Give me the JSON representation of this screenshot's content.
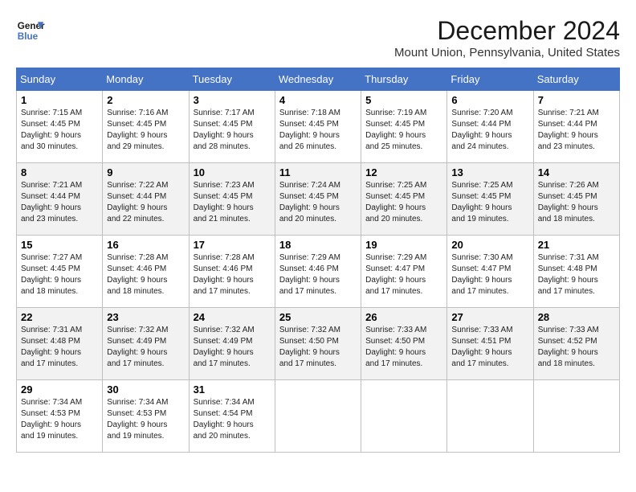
{
  "header": {
    "logo_line1": "General",
    "logo_line2": "Blue",
    "month_title": "December 2024",
    "location": "Mount Union, Pennsylvania, United States"
  },
  "weekdays": [
    "Sunday",
    "Monday",
    "Tuesday",
    "Wednesday",
    "Thursday",
    "Friday",
    "Saturday"
  ],
  "weeks": [
    [
      {
        "day": "1",
        "info": "Sunrise: 7:15 AM\nSunset: 4:45 PM\nDaylight: 9 hours\nand 30 minutes."
      },
      {
        "day": "2",
        "info": "Sunrise: 7:16 AM\nSunset: 4:45 PM\nDaylight: 9 hours\nand 29 minutes."
      },
      {
        "day": "3",
        "info": "Sunrise: 7:17 AM\nSunset: 4:45 PM\nDaylight: 9 hours\nand 28 minutes."
      },
      {
        "day": "4",
        "info": "Sunrise: 7:18 AM\nSunset: 4:45 PM\nDaylight: 9 hours\nand 26 minutes."
      },
      {
        "day": "5",
        "info": "Sunrise: 7:19 AM\nSunset: 4:45 PM\nDaylight: 9 hours\nand 25 minutes."
      },
      {
        "day": "6",
        "info": "Sunrise: 7:20 AM\nSunset: 4:44 PM\nDaylight: 9 hours\nand 24 minutes."
      },
      {
        "day": "7",
        "info": "Sunrise: 7:21 AM\nSunset: 4:44 PM\nDaylight: 9 hours\nand 23 minutes."
      }
    ],
    [
      {
        "day": "8",
        "info": "Sunrise: 7:21 AM\nSunset: 4:44 PM\nDaylight: 9 hours\nand 23 minutes."
      },
      {
        "day": "9",
        "info": "Sunrise: 7:22 AM\nSunset: 4:44 PM\nDaylight: 9 hours\nand 22 minutes."
      },
      {
        "day": "10",
        "info": "Sunrise: 7:23 AM\nSunset: 4:45 PM\nDaylight: 9 hours\nand 21 minutes."
      },
      {
        "day": "11",
        "info": "Sunrise: 7:24 AM\nSunset: 4:45 PM\nDaylight: 9 hours\nand 20 minutes."
      },
      {
        "day": "12",
        "info": "Sunrise: 7:25 AM\nSunset: 4:45 PM\nDaylight: 9 hours\nand 20 minutes."
      },
      {
        "day": "13",
        "info": "Sunrise: 7:25 AM\nSunset: 4:45 PM\nDaylight: 9 hours\nand 19 minutes."
      },
      {
        "day": "14",
        "info": "Sunrise: 7:26 AM\nSunset: 4:45 PM\nDaylight: 9 hours\nand 18 minutes."
      }
    ],
    [
      {
        "day": "15",
        "info": "Sunrise: 7:27 AM\nSunset: 4:45 PM\nDaylight: 9 hours\nand 18 minutes."
      },
      {
        "day": "16",
        "info": "Sunrise: 7:28 AM\nSunset: 4:46 PM\nDaylight: 9 hours\nand 18 minutes."
      },
      {
        "day": "17",
        "info": "Sunrise: 7:28 AM\nSunset: 4:46 PM\nDaylight: 9 hours\nand 17 minutes."
      },
      {
        "day": "18",
        "info": "Sunrise: 7:29 AM\nSunset: 4:46 PM\nDaylight: 9 hours\nand 17 minutes."
      },
      {
        "day": "19",
        "info": "Sunrise: 7:29 AM\nSunset: 4:47 PM\nDaylight: 9 hours\nand 17 minutes."
      },
      {
        "day": "20",
        "info": "Sunrise: 7:30 AM\nSunset: 4:47 PM\nDaylight: 9 hours\nand 17 minutes."
      },
      {
        "day": "21",
        "info": "Sunrise: 7:31 AM\nSunset: 4:48 PM\nDaylight: 9 hours\nand 17 minutes."
      }
    ],
    [
      {
        "day": "22",
        "info": "Sunrise: 7:31 AM\nSunset: 4:48 PM\nDaylight: 9 hours\nand 17 minutes."
      },
      {
        "day": "23",
        "info": "Sunrise: 7:32 AM\nSunset: 4:49 PM\nDaylight: 9 hours\nand 17 minutes."
      },
      {
        "day": "24",
        "info": "Sunrise: 7:32 AM\nSunset: 4:49 PM\nDaylight: 9 hours\nand 17 minutes."
      },
      {
        "day": "25",
        "info": "Sunrise: 7:32 AM\nSunset: 4:50 PM\nDaylight: 9 hours\nand 17 minutes."
      },
      {
        "day": "26",
        "info": "Sunrise: 7:33 AM\nSunset: 4:50 PM\nDaylight: 9 hours\nand 17 minutes."
      },
      {
        "day": "27",
        "info": "Sunrise: 7:33 AM\nSunset: 4:51 PM\nDaylight: 9 hours\nand 17 minutes."
      },
      {
        "day": "28",
        "info": "Sunrise: 7:33 AM\nSunset: 4:52 PM\nDaylight: 9 hours\nand 18 minutes."
      }
    ],
    [
      {
        "day": "29",
        "info": "Sunrise: 7:34 AM\nSunset: 4:53 PM\nDaylight: 9 hours\nand 19 minutes."
      },
      {
        "day": "30",
        "info": "Sunrise: 7:34 AM\nSunset: 4:53 PM\nDaylight: 9 hours\nand 19 minutes."
      },
      {
        "day": "31",
        "info": "Sunrise: 7:34 AM\nSunset: 4:54 PM\nDaylight: 9 hours\nand 20 minutes."
      },
      {
        "day": "",
        "info": ""
      },
      {
        "day": "",
        "info": ""
      },
      {
        "day": "",
        "info": ""
      },
      {
        "day": "",
        "info": ""
      }
    ]
  ]
}
